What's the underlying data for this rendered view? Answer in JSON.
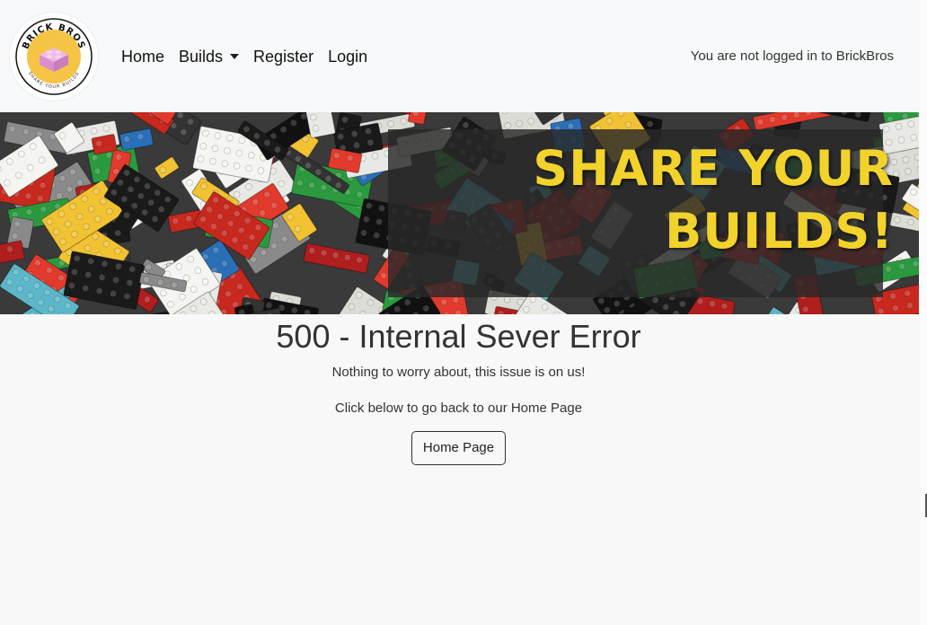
{
  "brand": {
    "logo_top_text": "BRICK BROS",
    "logo_bottom_text": "SHARE YOUR BUILDS",
    "logo_colors": {
      "ring": "#f6c445",
      "brick": "#e6a3d8"
    }
  },
  "nav": {
    "items": [
      {
        "label": "Home"
      },
      {
        "label": "Builds"
      },
      {
        "label": "Register"
      },
      {
        "label": "Login"
      }
    ],
    "status": "You are not logged in to BrickBros"
  },
  "banner": {
    "line1": "SHARE YOUR",
    "line2": "BUILDS!",
    "text_color": "#f2d32b"
  },
  "error": {
    "title": "500 - Internal Sever Error",
    "message": "Nothing to worry about, this issue is on us!",
    "instruction": "Click below to go back to our Home Page",
    "button_label": "Home Page"
  }
}
